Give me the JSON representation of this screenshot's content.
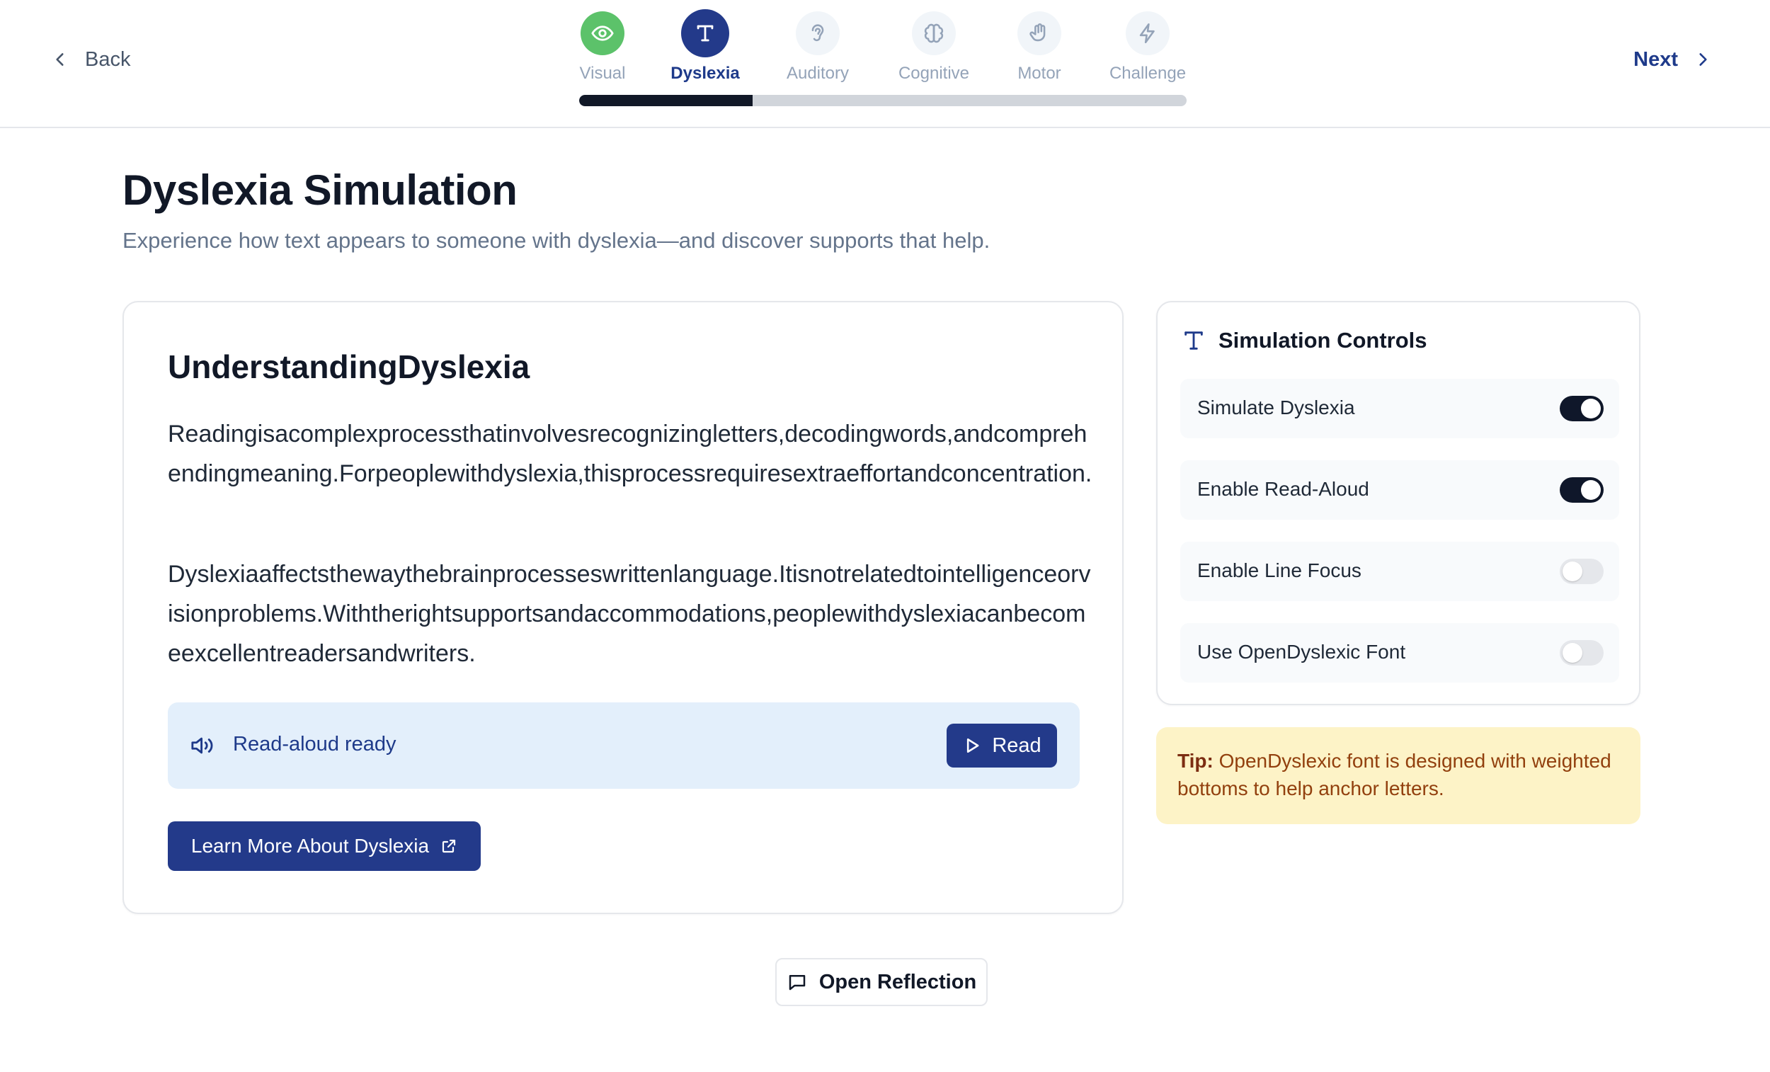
{
  "header": {
    "back_label": "Back",
    "next_label": "Next",
    "steps": [
      {
        "label": "Visual",
        "icon": "eye-icon",
        "state": "done"
      },
      {
        "label": "Dyslexia",
        "icon": "type-icon",
        "state": "active"
      },
      {
        "label": "Auditory",
        "icon": "ear-icon",
        "state": "upcoming"
      },
      {
        "label": "Cognitive",
        "icon": "brain-icon",
        "state": "upcoming"
      },
      {
        "label": "Motor",
        "icon": "hand-icon",
        "state": "upcoming"
      },
      {
        "label": "Challenge",
        "icon": "bolt-icon",
        "state": "upcoming"
      }
    ],
    "progress_fraction": 0.286
  },
  "page": {
    "title": "Dyslexia Simulation",
    "subtitle": "Experience how text appears to someone with dyslexia—and discover supports that help."
  },
  "content": {
    "heading": "UnderstandingDyslexia",
    "paragraph1": "Readingisacomplexprocessthatinvolvesrecognizingletters,decodingwords,andcomprehendingmeaning.Forpeoplewithdyslexia,thisprocessrequiresextraeffortandconcentration.",
    "paragraph2": "Dyslexiaaffectsthewaythebrainprocesseswrittenlanguage.Itisnotrelatedtointelligenceorvisionproblems.Withtherightsupportsandaccommodations,peoplewithdyslexiacanbecomeexcellentreadersandwriters.",
    "read_status": "Read-aloud ready",
    "read_button": "Read",
    "learn_more_button": "Learn More About Dyslexia"
  },
  "controls": {
    "title": "Simulation Controls",
    "items": [
      {
        "label": "Simulate Dyslexia",
        "on": true
      },
      {
        "label": "Enable Read-Aloud",
        "on": true
      },
      {
        "label": "Enable Line Focus",
        "on": false
      },
      {
        "label": "Use OpenDyslexic Font",
        "on": false
      }
    ]
  },
  "tip": {
    "prefix": "Tip:",
    "text": " OpenDyslexic font is designed with weighted bottoms to help anchor letters."
  },
  "reflection": {
    "button_label": "Open Reflection"
  },
  "colors": {
    "primary": "#233a8a",
    "done": "#5cc26a",
    "tip_bg": "#fdf3c7",
    "read_panel_bg": "#e3effb"
  }
}
